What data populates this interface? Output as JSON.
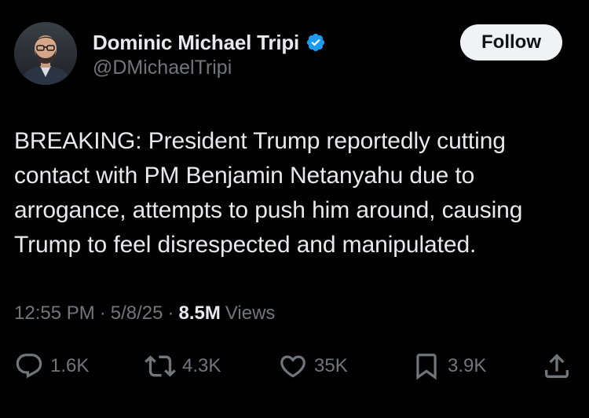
{
  "author": {
    "display_name": "Dominic Michael Tripi",
    "handle": "@DMichaelTripi",
    "verified_icon": "verified-badge-icon"
  },
  "follow_button": {
    "label": "Follow"
  },
  "tweet": {
    "text_lines": [
      "BREAKING: President Trump reportedly cutting",
      "contact with PM Benjamin Netanyahu due to",
      "arrogance, attempts to push him around, causing",
      "Trump to feel disrespected and manipulated."
    ],
    "time": "12:55 PM",
    "separator": "·",
    "date": "5/8/25",
    "views_count": "8.5M",
    "views_label": "Views"
  },
  "actions": {
    "reply_count": "1.6K",
    "repost_count": "4.3K",
    "like_count": "35K",
    "bookmark_count": "3.9K"
  },
  "colors": {
    "background": "#000000",
    "primary_text": "#e7e9ea",
    "secondary_text": "#71767b",
    "verified_blue": "#1d9bf0",
    "follow_bg": "#eff3f4"
  }
}
